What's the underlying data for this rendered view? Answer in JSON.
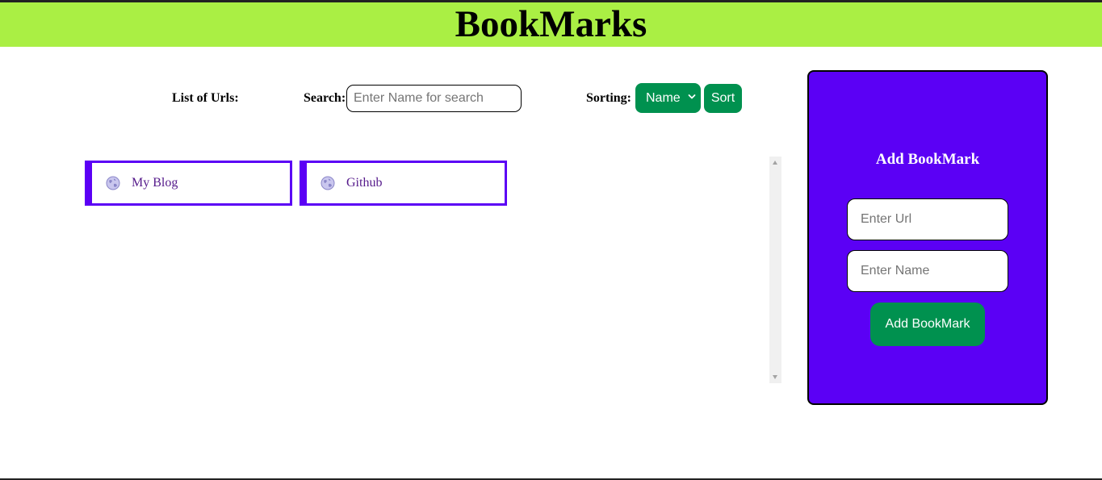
{
  "header": {
    "title": "BookMarks"
  },
  "toolbar": {
    "list_label": "List of Urls:",
    "search_label": "Search:",
    "search_placeholder": "Enter Name for search",
    "search_value": "",
    "sorting_label": "Sorting:",
    "sort_selected": "Name",
    "sort_button_label": "Sort"
  },
  "bookmarks": [
    {
      "name": "My Blog",
      "icon": "globe-icon"
    },
    {
      "name": "Github",
      "icon": "globe-icon"
    }
  ],
  "add_panel": {
    "title": "Add BookMark",
    "url_placeholder": "Enter Url",
    "name_placeholder": "Enter Name",
    "button_label": "Add BookMark"
  },
  "colors": {
    "header_bg": "#aaef44",
    "accent_purple": "#5b00f5",
    "button_green": "#00914f",
    "link_purple": "#551a8b"
  }
}
